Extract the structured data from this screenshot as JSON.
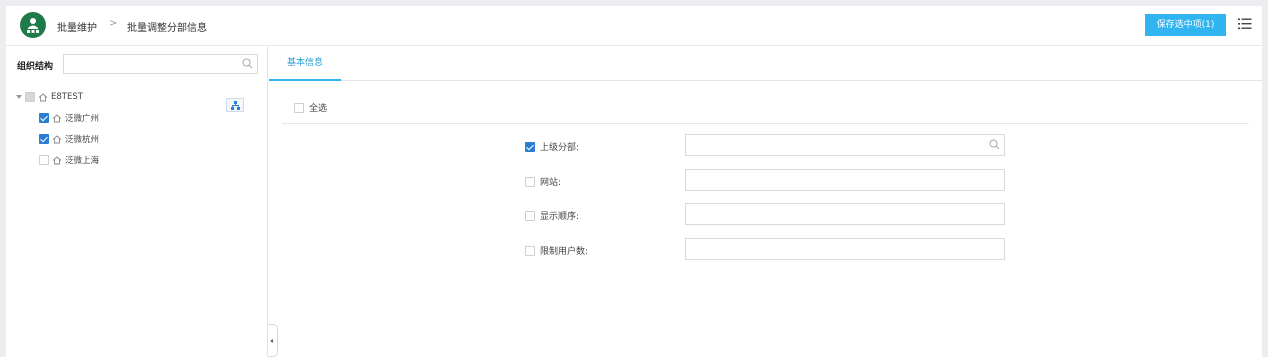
{
  "header": {
    "breadcrumb": [
      "批量维护",
      "批量调整分部信息"
    ],
    "separator": ">",
    "save_label": "保存选中项(1)",
    "logo_icon": "person-network-icon",
    "menu_icon": "list-menu-icon",
    "accent_color": "#30b5f0",
    "logo_color": "#1f7a4a"
  },
  "left_panel": {
    "org_label": "组织结构",
    "search_placeholder": "",
    "tree": [
      {
        "label": "E8TEST",
        "checked": "partial",
        "level": 0,
        "icon": "home-icon"
      },
      {
        "label": "泛微广州",
        "checked": true,
        "level": 1,
        "icon": "home-icon"
      },
      {
        "label": "泛微杭州",
        "checked": true,
        "level": 1,
        "icon": "home-icon"
      },
      {
        "label": "泛微上海",
        "checked": false,
        "level": 1,
        "icon": "home-icon"
      }
    ]
  },
  "main": {
    "tab_label": "基本信息",
    "select_all_label": "全选",
    "fields": [
      {
        "label": "上级分部:",
        "checked": true,
        "value": "",
        "has_search": true
      },
      {
        "label": "网站:",
        "checked": false,
        "value": ""
      },
      {
        "label": "显示顺序:",
        "checked": false,
        "value": ""
      },
      {
        "label": "限制用户数:",
        "checked": false,
        "value": ""
      }
    ]
  }
}
